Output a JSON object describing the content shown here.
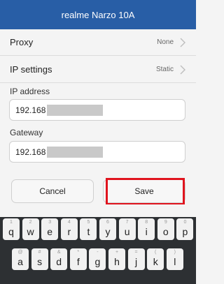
{
  "window": {
    "title": "realme Narzo 10A"
  },
  "settings": {
    "proxy": {
      "label": "Proxy",
      "value": "None"
    },
    "ip_settings": {
      "label": "IP settings",
      "value": "Static"
    }
  },
  "ip_address": {
    "label": "IP address",
    "value": "192.168"
  },
  "gateway": {
    "label": "Gateway",
    "value": "192.168"
  },
  "buttons": {
    "cancel": "Cancel",
    "save": "Save"
  },
  "keyboard": {
    "row1": [
      {
        "key": "q",
        "sub": "1"
      },
      {
        "key": "w",
        "sub": "2"
      },
      {
        "key": "e",
        "sub": "3"
      },
      {
        "key": "r",
        "sub": "4"
      },
      {
        "key": "t",
        "sub": "5"
      },
      {
        "key": "y",
        "sub": "6"
      },
      {
        "key": "u",
        "sub": "7"
      },
      {
        "key": "i",
        "sub": "8"
      },
      {
        "key": "o",
        "sub": "9"
      },
      {
        "key": "p",
        "sub": "0"
      }
    ],
    "row2": [
      {
        "key": "a",
        "sub": "@"
      },
      {
        "key": "s",
        "sub": "#"
      },
      {
        "key": "d",
        "sub": "&"
      },
      {
        "key": "f",
        "sub": "*"
      },
      {
        "key": "g",
        "sub": "-"
      },
      {
        "key": "h",
        "sub": "+"
      },
      {
        "key": "j",
        "sub": "="
      },
      {
        "key": "k",
        "sub": "("
      },
      {
        "key": "l",
        "sub": ")"
      }
    ]
  },
  "colors": {
    "titlebar": "#285ea6",
    "highlight": "#e0141e"
  },
  "icons": {
    "row_chevron": "chevron-right-icon"
  }
}
